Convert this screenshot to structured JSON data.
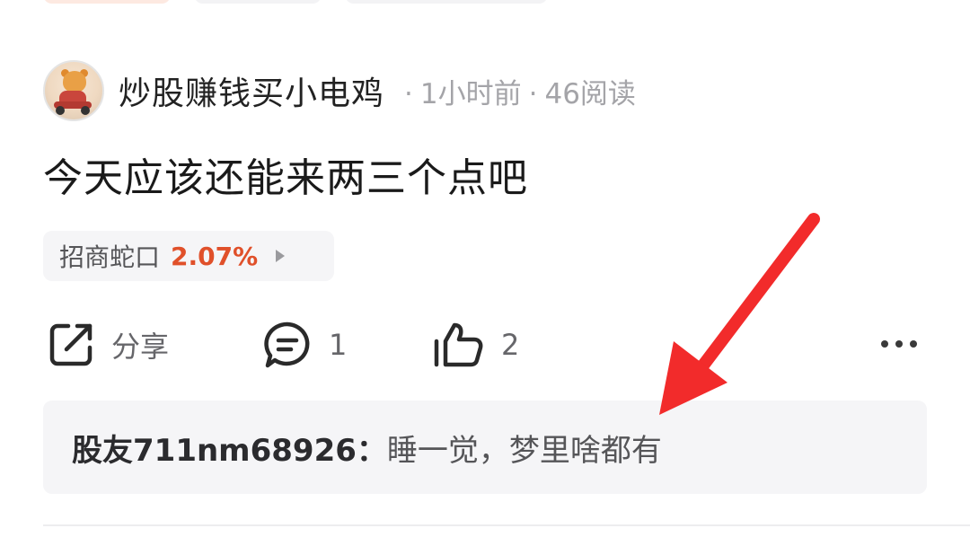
{
  "author": {
    "name": "炒股赚钱买小电鸡",
    "time": "1小时前",
    "reads": "46阅读",
    "separator": "·"
  },
  "post": {
    "text": "今天应该还能来两三个点吧"
  },
  "stock": {
    "name": "招商蛇口",
    "change": "2.07%",
    "change_color": "#e0502a"
  },
  "actions": {
    "share_label": "分享",
    "comment_count": "1",
    "like_count": "2"
  },
  "comment": {
    "user": "股友711nm68926：",
    "text": "睡一觉，梦里啥都有"
  },
  "icons": {
    "share": "share-icon",
    "comment": "comment-icon",
    "like": "thumbs-up-icon",
    "more": "more-icon",
    "stock_arrow": "play-arrow-icon",
    "annotation": "red-arrow-annotation"
  },
  "colors": {
    "annotation_red": "#f22b2b",
    "accent_orange": "#e0502a"
  }
}
